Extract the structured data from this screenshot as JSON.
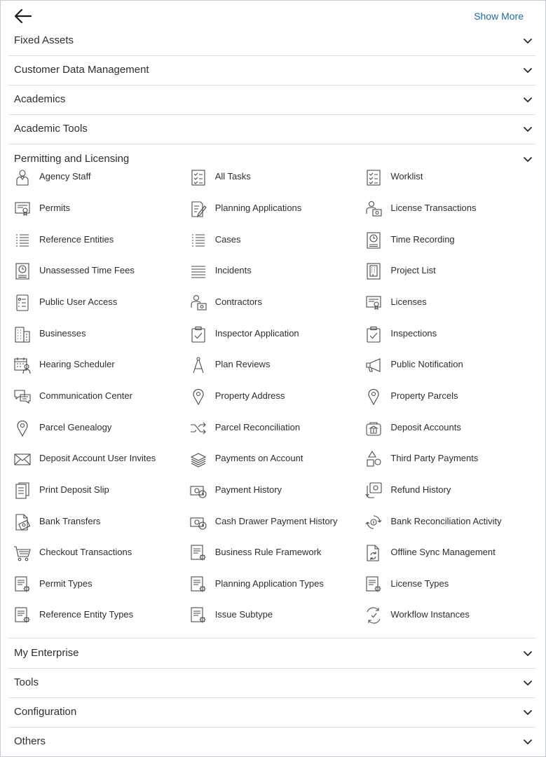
{
  "header": {
    "show_more_label": "Show More"
  },
  "sections_top": [
    {
      "label": "Fixed Assets"
    },
    {
      "label": "Customer Data Management"
    },
    {
      "label": "Academics"
    },
    {
      "label": "Academic Tools"
    },
    {
      "label": "Permitting and Licensing"
    }
  ],
  "permitting_items": [
    {
      "label": "Agency Staff",
      "icon": "person-icon"
    },
    {
      "label": "All Tasks",
      "icon": "checklist-icon"
    },
    {
      "label": "Worklist",
      "icon": "checklist-icon"
    },
    {
      "label": "Permits",
      "icon": "certificate-icon"
    },
    {
      "label": "Planning Applications",
      "icon": "edit-document-icon"
    },
    {
      "label": "License Transactions",
      "icon": "person-certificate-icon"
    },
    {
      "label": "Reference Entities",
      "icon": "list-icon"
    },
    {
      "label": "Cases",
      "icon": "list-icon"
    },
    {
      "label": "Time Recording",
      "icon": "clock-document-icon"
    },
    {
      "label": "Unassessed Time Fees",
      "icon": "clock-document-icon"
    },
    {
      "label": "Incidents",
      "icon": "lines-icon"
    },
    {
      "label": "Project List",
      "icon": "building-document-icon"
    },
    {
      "label": "Public User Access",
      "icon": "user-list-icon"
    },
    {
      "label": "Contractors",
      "icon": "person-certificate-icon"
    },
    {
      "label": "Licenses",
      "icon": "certificate-icon"
    },
    {
      "label": "Businesses",
      "icon": "building-icon"
    },
    {
      "label": "Inspector Application",
      "icon": "clipboard-check-icon"
    },
    {
      "label": "Inspections",
      "icon": "clipboard-check-icon"
    },
    {
      "label": "Hearing Scheduler",
      "icon": "calendar-people-icon"
    },
    {
      "label": "Plan Reviews",
      "icon": "compass-icon"
    },
    {
      "label": "Public Notification",
      "icon": "megaphone-icon"
    },
    {
      "label": "Communication Center",
      "icon": "chat-icon"
    },
    {
      "label": "Property Address",
      "icon": "location-pin-icon"
    },
    {
      "label": "Property Parcels",
      "icon": "location-pin-icon"
    },
    {
      "label": "Parcel Genealogy",
      "icon": "location-pin-icon"
    },
    {
      "label": "Parcel Reconciliation",
      "icon": "shuffle-icon"
    },
    {
      "label": "Deposit Accounts",
      "icon": "bank-icon"
    },
    {
      "label": "Deposit Account User Invites",
      "icon": "envelope-icon"
    },
    {
      "label": "Payments on Account",
      "icon": "cash-stack-icon"
    },
    {
      "label": "Third Party Payments",
      "icon": "shapes-icon"
    },
    {
      "label": "Print Deposit Slip",
      "icon": "documents-icon"
    },
    {
      "label": "Payment History",
      "icon": "money-clock-icon"
    },
    {
      "label": "Refund History",
      "icon": "refund-icon"
    },
    {
      "label": "Bank Transfers",
      "icon": "document-money-icon"
    },
    {
      "label": "Cash Drawer Payment History",
      "icon": "money-clock-icon"
    },
    {
      "label": "Bank Reconciliation Activity",
      "icon": "reconcile-icon"
    },
    {
      "label": "Checkout Transactions",
      "icon": "cart-icon"
    },
    {
      "label": "Business Rule Framework",
      "icon": "document-gear-icon"
    },
    {
      "label": "Offline Sync Management",
      "icon": "sync-document-icon"
    },
    {
      "label": "Permit Types",
      "icon": "document-gear-icon"
    },
    {
      "label": "Planning Application Types",
      "icon": "document-gear-icon"
    },
    {
      "label": "License Types",
      "icon": "document-gear-icon"
    },
    {
      "label": "Reference Entity Types",
      "icon": "document-gear-icon"
    },
    {
      "label": "Issue Subtype",
      "icon": "document-gear-icon"
    },
    {
      "label": "Workflow Instances",
      "icon": "workflow-icon"
    }
  ],
  "sections_bottom": [
    {
      "label": "My Enterprise"
    },
    {
      "label": "Tools"
    },
    {
      "label": "Configuration"
    },
    {
      "label": "Others"
    }
  ],
  "colors": {
    "link": "#1c6c9a",
    "divider": "#dcdfe3",
    "icon_stroke": "#4a4a4a"
  }
}
